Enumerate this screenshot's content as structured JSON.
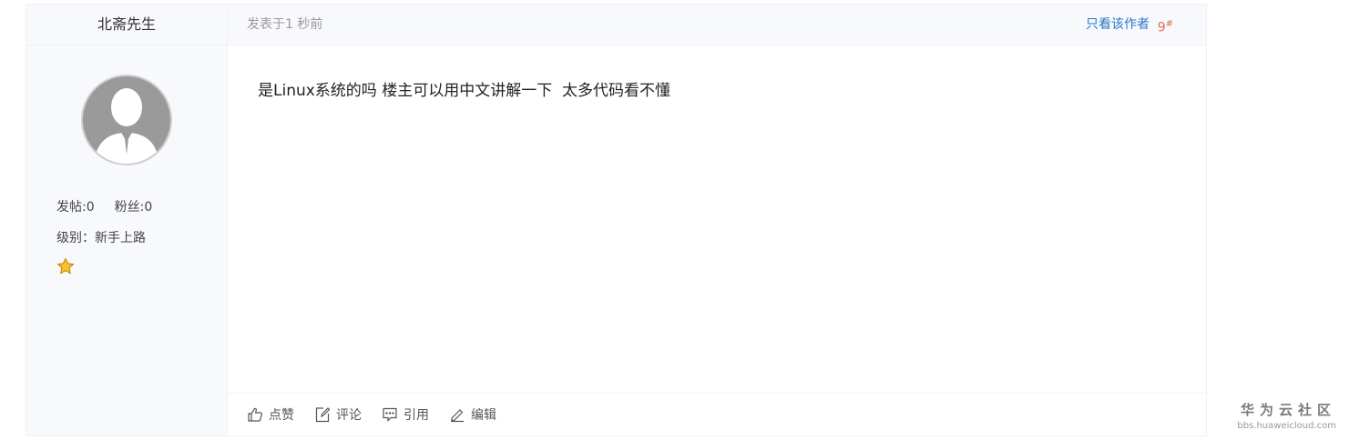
{
  "author": {
    "name": "北斋先生",
    "posts_label": "发帖:0",
    "fans_label": "粉丝:0",
    "level_label": "级别：新手上路"
  },
  "post": {
    "time": "发表于1 秒前",
    "only_author": "只看该作者",
    "floor_number": "9",
    "floor_mark": "#",
    "content": "是Linux系统的吗 楼主可以用中文讲解一下  太多代码看不懂"
  },
  "actions": [
    {
      "label": "点赞",
      "icon": "thumbs-up-icon"
    },
    {
      "label": "评论",
      "icon": "edit-comment-icon"
    },
    {
      "label": "引用",
      "icon": "quote-bubble-icon"
    },
    {
      "label": "编辑",
      "icon": "pencil-icon"
    }
  ],
  "brand": {
    "title": "华为云社区",
    "url": "bbs.huaweicloud.com"
  },
  "colors": {
    "link": "#2a78c6",
    "floor": "#e06a4a",
    "panel_bg": "#f8f9fd"
  }
}
